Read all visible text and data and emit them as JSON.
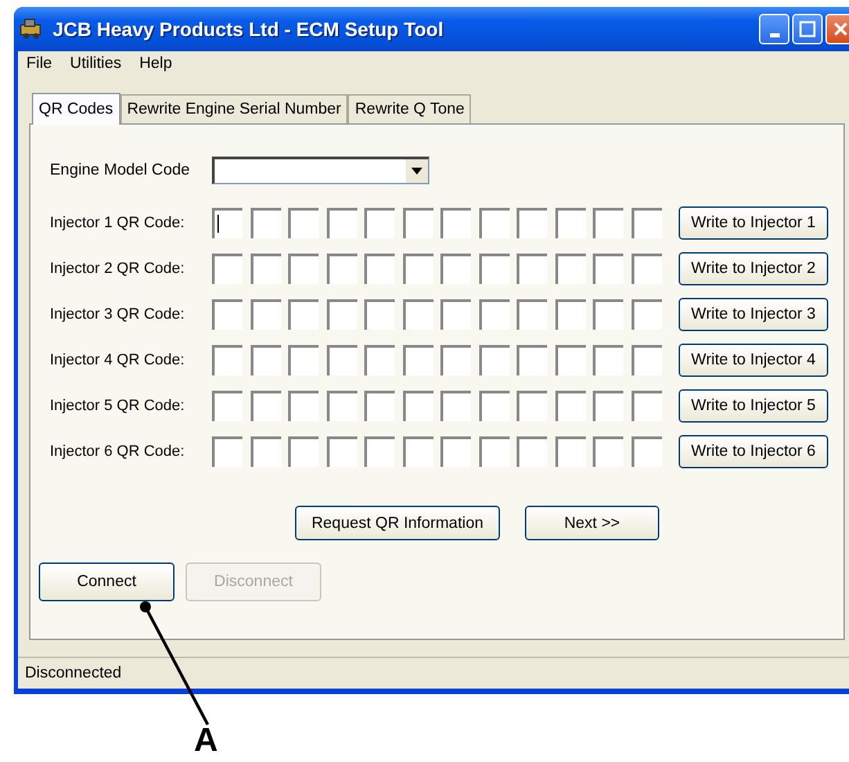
{
  "window": {
    "title": "JCB Heavy Products Ltd - ECM Setup Tool"
  },
  "menu": [
    "File",
    "Utilities",
    "Help"
  ],
  "tabs": [
    {
      "label": "QR Codes",
      "selected": true
    },
    {
      "label": "Rewrite Engine Serial Number",
      "selected": false
    },
    {
      "label": "Rewrite Q Tone",
      "selected": false
    }
  ],
  "engine_model": {
    "label": "Engine Model Code"
  },
  "injectors": [
    {
      "label": "Injector 1 QR Code:",
      "focused": true,
      "button": "Write to Injector 1"
    },
    {
      "label": "Injector 2 QR Code:",
      "focused": false,
      "button": "Write to Injector 2"
    },
    {
      "label": "Injector 3 QR Code:",
      "focused": false,
      "button": "Write to Injector 3"
    },
    {
      "label": "Injector 4 QR Code:",
      "focused": false,
      "button": "Write to Injector 4"
    },
    {
      "label": "Injector 5 QR Code:",
      "focused": false,
      "button": "Write to Injector 5"
    },
    {
      "label": "Injector 6 QR Code:",
      "focused": false,
      "button": "Write to Injector 6"
    }
  ],
  "action_buttons": [
    {
      "label": "Request QR Information",
      "disabled": false
    },
    {
      "label": "Next >>",
      "disabled": false
    }
  ],
  "connection_buttons": [
    {
      "label": "Connect",
      "disabled": false
    },
    {
      "label": "Disconnect",
      "disabled": true
    }
  ],
  "status_bar": "Disconnected",
  "callout": {
    "label": "A"
  }
}
